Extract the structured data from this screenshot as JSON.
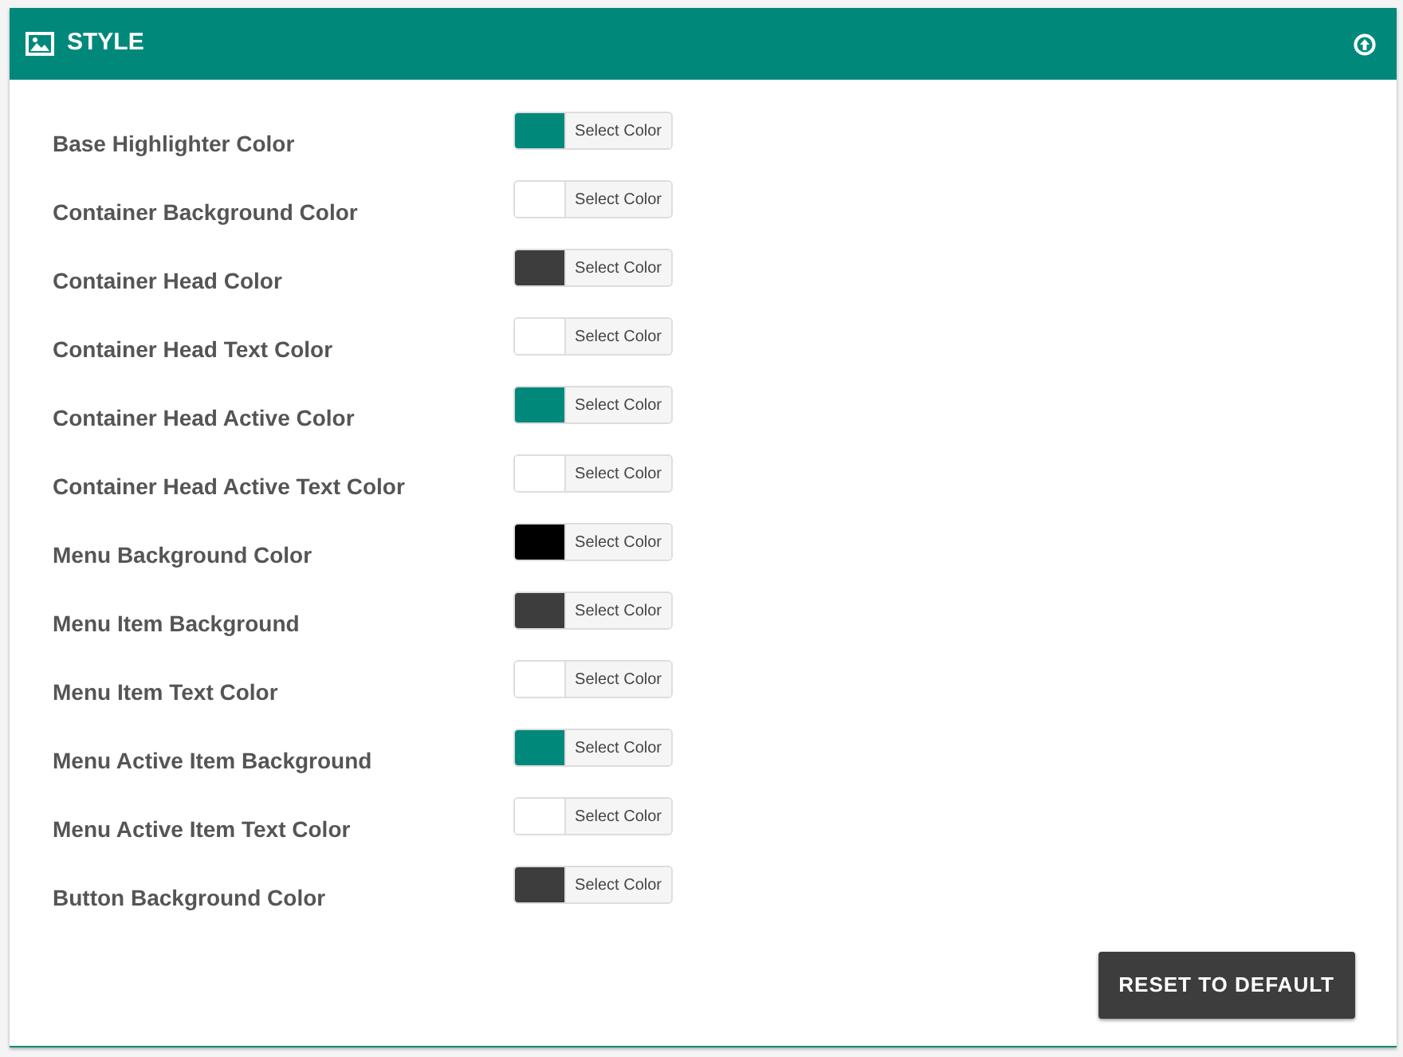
{
  "panel": {
    "title": "STYLE"
  },
  "settings": [
    {
      "label": "Base Highlighter Color",
      "color": "#00897b",
      "button": "Select Color"
    },
    {
      "label": "Container Background Color",
      "color": "#ffffff",
      "button": "Select Color"
    },
    {
      "label": "Container Head Color",
      "color": "#3d3d3d",
      "button": "Select Color"
    },
    {
      "label": "Container Head Text Color",
      "color": "#ffffff",
      "button": "Select Color"
    },
    {
      "label": "Container Head Active Color",
      "color": "#00897b",
      "button": "Select Color"
    },
    {
      "label": "Container Head Active Text Color",
      "color": "#ffffff",
      "button": "Select Color"
    },
    {
      "label": "Menu Background Color",
      "color": "#000000",
      "button": "Select Color"
    },
    {
      "label": "Menu Item Background",
      "color": "#3d3d3d",
      "button": "Select Color"
    },
    {
      "label": "Menu Item Text Color",
      "color": "#ffffff",
      "button": "Select Color"
    },
    {
      "label": "Menu Active Item Background",
      "color": "#00897b",
      "button": "Select Color"
    },
    {
      "label": "Menu Active Item Text Color",
      "color": "#ffffff",
      "button": "Select Color"
    },
    {
      "label": "Button Background Color",
      "color": "#3d3d3d",
      "button": "Select Color"
    }
  ],
  "reset_button": "RESET TO DEFAULT"
}
